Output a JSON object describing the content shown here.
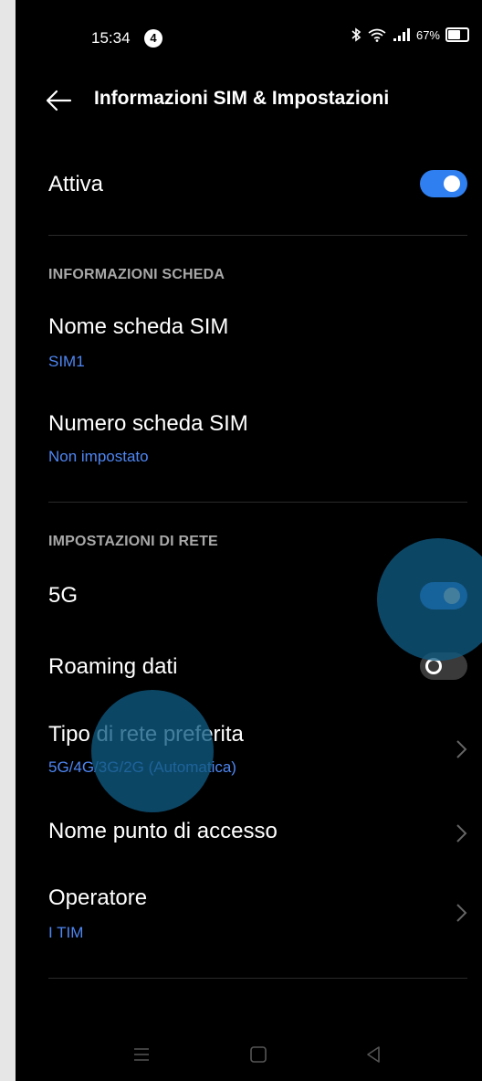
{
  "status_bar": {
    "time": "15:34",
    "notification_count": "4",
    "battery": "67%"
  },
  "header": {
    "title": "Informazioni SIM & Impostazioni"
  },
  "active": {
    "label": "Attiva",
    "enabled": true
  },
  "card_info": {
    "section_title": "INFORMAZIONI SCHEDA",
    "sim_name": {
      "label": "Nome scheda SIM",
      "value": "SIM1"
    },
    "sim_number": {
      "label": "Numero scheda SIM",
      "value": "Non impostato"
    }
  },
  "network": {
    "section_title": "IMPOSTAZIONI DI RETE",
    "five_g": {
      "label": "5G",
      "enabled": true
    },
    "roaming": {
      "label": "Roaming dati",
      "enabled": false
    },
    "network_type": {
      "label": "Tipo di rete preferita",
      "value": "5G/4G/3G/2G (Automatica)"
    },
    "apn": {
      "label": "Nome punto di accesso"
    },
    "operator": {
      "label": "Operatore",
      "value": "I TIM"
    }
  },
  "colors": {
    "accent": "#2f7ff0",
    "link": "#4e86f2",
    "background": "#000000",
    "section": "#a8a8a8"
  },
  "icons": [
    "back-arrow-icon",
    "bluetooth-icon",
    "wifi-icon",
    "signal-icon",
    "battery-icon",
    "chevron-right-icon",
    "menu-icon",
    "home-icon",
    "back-triangle-icon"
  ]
}
